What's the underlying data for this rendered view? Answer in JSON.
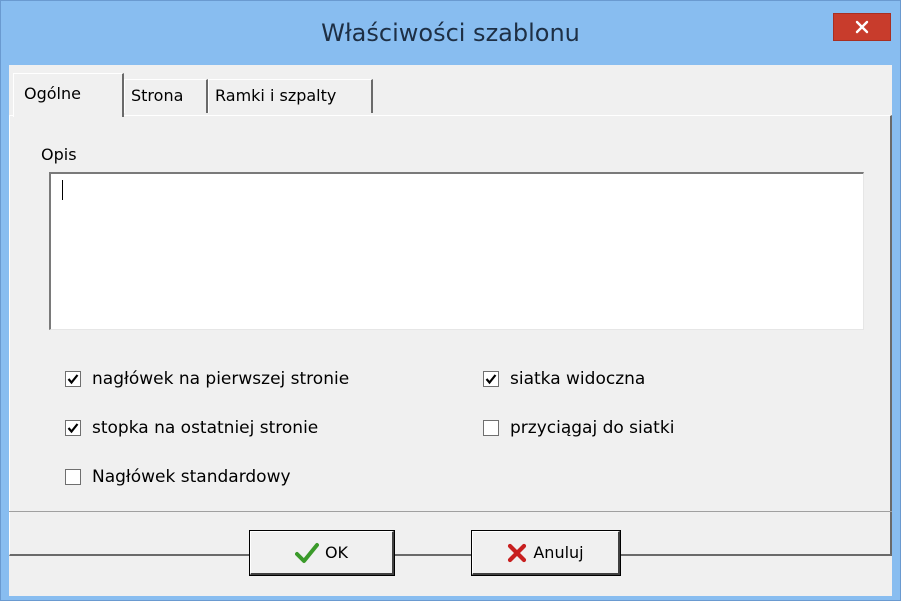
{
  "window": {
    "title": "Właściwości szablonu",
    "close_icon": "close-icon"
  },
  "tabs": [
    {
      "label": "Ogólne",
      "active": true
    },
    {
      "label": "Strona",
      "active": false
    },
    {
      "label": "Ramki i szpalty",
      "active": false
    }
  ],
  "general": {
    "description_label": "Opis",
    "description_value": ""
  },
  "checkboxes": {
    "header_first_page": {
      "label": "nagłówek na pierwszej stronie",
      "checked": true
    },
    "footer_last_page": {
      "label": "stopka na ostatniej stronie",
      "checked": true
    },
    "standard_header": {
      "label": "Nagłówek standardowy",
      "checked": false
    },
    "grid_visible": {
      "label": "siatka widoczna",
      "checked": true
    },
    "snap_to_grid": {
      "label": "przyciągaj do siatki",
      "checked": false
    }
  },
  "buttons": {
    "ok_label": "OK",
    "ok_icon": "checkmark-icon",
    "cancel_label": "Anuluj",
    "cancel_icon": "red-x-icon"
  },
  "colors": {
    "titlebar": "#88bdf0",
    "close_button": "#c83c2c",
    "ok_icon": "#3a9a2a",
    "cancel_icon": "#c82020"
  }
}
